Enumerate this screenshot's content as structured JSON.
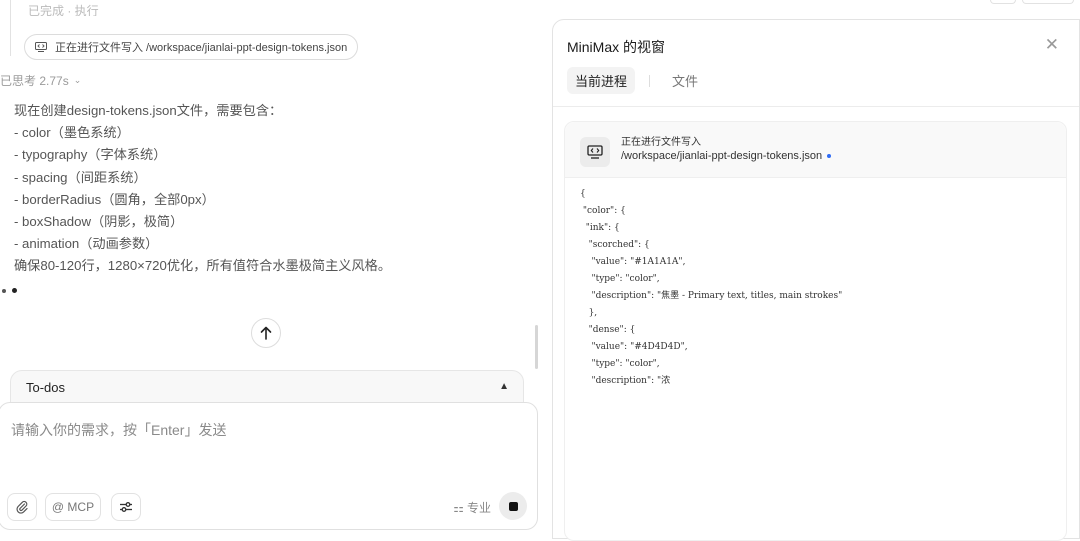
{
  "left": {
    "cut_top_text": "已完成 · 执行",
    "file_chip": "正在进行文件写入 /workspace/jianlai-ppt-design-tokens.json",
    "thought_label": "已思考 2.77s",
    "thought_lines": [
      "现在创建design-tokens.json文件，需要包含：",
      "- color（墨色系统）",
      "- typography（字体系统）",
      "- spacing（间距系统）",
      "- borderRadius（圆角，全部0px）",
      "- boxShadow（阴影，极简）",
      "- animation（动画参数）",
      "确保80-120行，1280×720优化，所有值符合水墨极简主义风格。"
    ],
    "todos_label": "To-dos",
    "composer_placeholder": "请输入你的需求，按「Enter」发送",
    "mcp_label": "@ MCP",
    "mode_label": "专业"
  },
  "panel": {
    "title": "MiniMax 的视窗",
    "tabs": [
      "当前进程",
      "文件"
    ],
    "card_title": "正在进行文件写入",
    "card_path": "/workspace/jianlai-ppt-design-tokens.json",
    "code": "{\n \"color\": {\n  \"ink\": {\n   \"scorched\": {\n    \"value\": \"#1A1A1A\",\n    \"type\": \"color\",\n    \"description\": \"焦墨 - Primary text, titles, main strokes\"\n   },\n   \"dense\": {\n    \"value\": \"#4D4D4D\",\n    \"type\": \"color\",\n    \"description\": \"浓"
  },
  "colors": {
    "accent_dot": "#2f6cf5",
    "stop_icon": "#111111"
  }
}
